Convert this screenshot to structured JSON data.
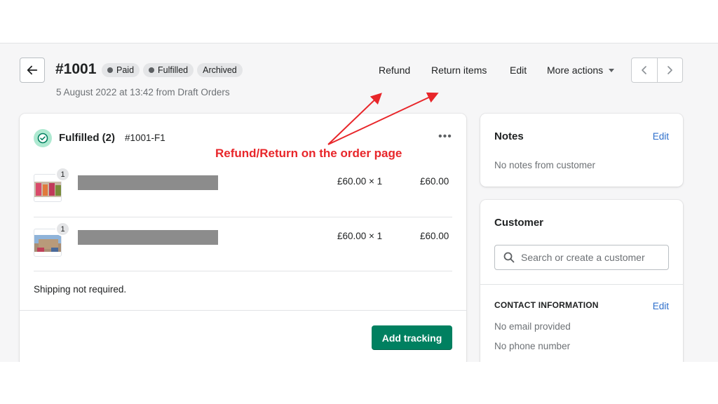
{
  "header": {
    "order_number": "#1001",
    "badges": [
      "Paid",
      "Fulfilled",
      "Archived"
    ],
    "subtitle": "5 August 2022 at 13:42 from Draft Orders",
    "actions": {
      "refund": "Refund",
      "return_items": "Return items",
      "edit": "Edit",
      "more_actions": "More actions"
    }
  },
  "fulfillment": {
    "title": "Fulfilled (2)",
    "id": "#1001-F1",
    "items": [
      {
        "quantity": "1",
        "price": "£60.00 × 1",
        "total": "£60.00"
      },
      {
        "quantity": "1",
        "price": "£60.00 × 1",
        "total": "£60.00"
      }
    ],
    "shipping_note": "Shipping not required.",
    "add_tracking": "Add tracking"
  },
  "annotation": {
    "text": "Refund/Return on the order page",
    "color": "#e8262a"
  },
  "notes": {
    "title": "Notes",
    "edit": "Edit",
    "body": "No notes from customer"
  },
  "customer": {
    "title": "Customer",
    "search_placeholder": "Search or create a customer",
    "contact_heading": "CONTACT INFORMATION",
    "edit": "Edit",
    "email": "No email provided",
    "phone": "No phone number"
  },
  "colors": {
    "primary_button": "#008060",
    "link": "#2c6ecb",
    "success_icon_bg": "#aee9d1"
  },
  "icons": [
    "arrow-left-icon",
    "chevron-left-icon",
    "chevron-right-icon",
    "caret-down-icon",
    "check-circle-icon",
    "ellipsis-icon",
    "search-icon"
  ]
}
